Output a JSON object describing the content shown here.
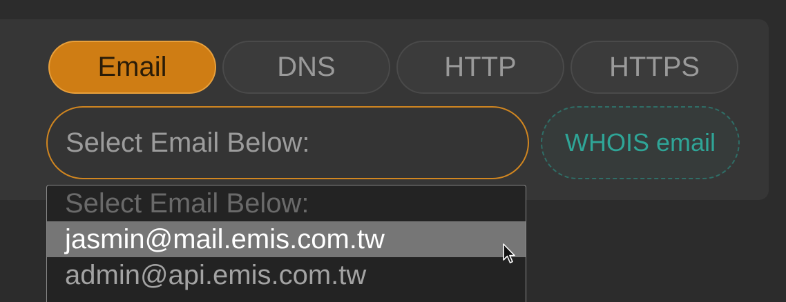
{
  "tabs": [
    {
      "label": "Email",
      "active": true
    },
    {
      "label": "DNS",
      "active": false
    },
    {
      "label": "HTTP",
      "active": false
    },
    {
      "label": "HTTPS",
      "active": false
    }
  ],
  "email_select": {
    "selected_value": "Select Email Below:",
    "options": [
      "Select Email Below:",
      "jasmin@mail.emis.com.tw",
      "admin@api.emis.com.tw"
    ],
    "highlighted_index": 1
  },
  "whois_button": {
    "label": "WHOIS email"
  },
  "colors": {
    "accent": "#cf7d14",
    "whois": "#2fa597",
    "highlight": "#767676"
  },
  "icons": {
    "pointer": "mouse-pointer-icon"
  }
}
